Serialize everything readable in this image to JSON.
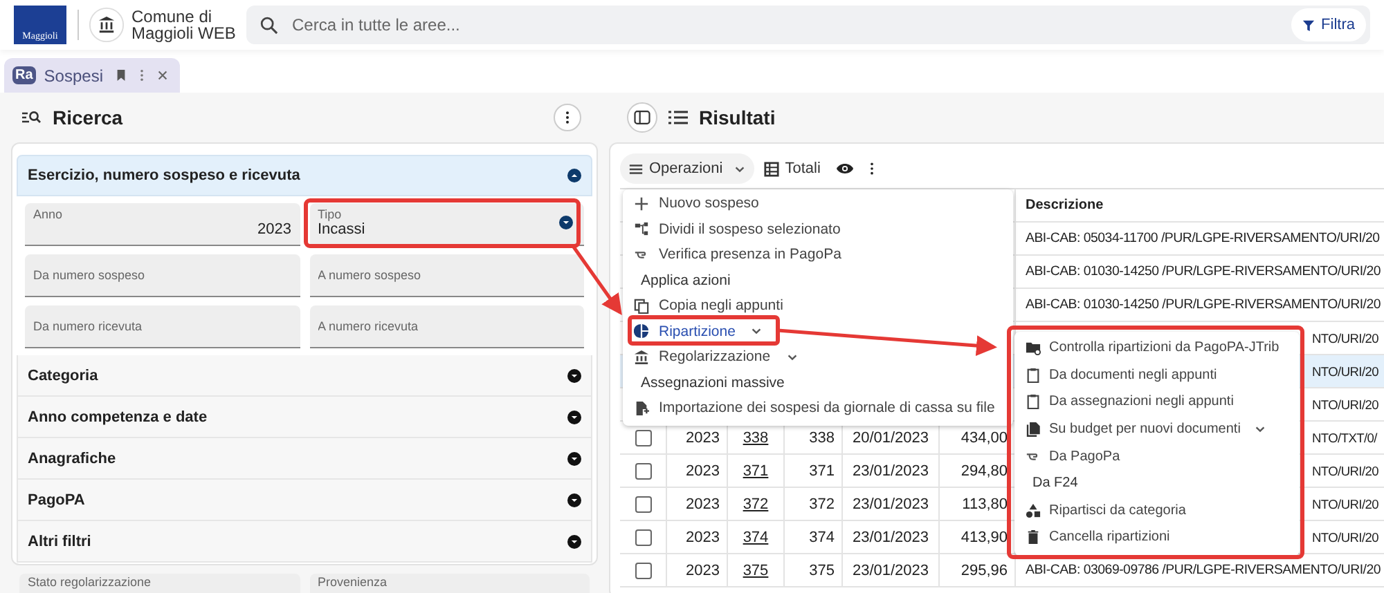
{
  "header": {
    "logo_text": "Maggioli",
    "app_title": "Comune di Maggioli WEB",
    "search": {
      "placeholder": "Cerca in tutte le aree..."
    },
    "filter_button": "Filtra"
  },
  "tabs": [
    {
      "icon_text": "Ra",
      "label": "Sospesi",
      "selected": true
    }
  ],
  "search_panel": {
    "title": "Ricerca",
    "sections": [
      {
        "title": "Esercizio, numero sospeso e ricevuta",
        "expanded": true,
        "fields": [
          {
            "kind": "value",
            "label": "Anno",
            "value": "2023"
          },
          {
            "kind": "select",
            "label": "Tipo",
            "value": "Incassi"
          },
          {
            "kind": "empty",
            "placeholder": "Da numero sospeso"
          },
          {
            "kind": "empty",
            "placeholder": "A numero sospeso"
          },
          {
            "kind": "empty",
            "placeholder": "Da numero ricevuta"
          },
          {
            "kind": "empty",
            "placeholder": "A numero ricevuta"
          }
        ]
      },
      {
        "title": "Categoria",
        "expanded": false
      },
      {
        "title": "Anno competenza e date",
        "expanded": false
      },
      {
        "title": "Anagrafiche",
        "expanded": false
      },
      {
        "title": "PagoPA",
        "expanded": false
      },
      {
        "title": "Altri filtri",
        "expanded": false
      }
    ],
    "extra_fields": [
      {
        "label": "Stato regolarizzazione"
      },
      {
        "label": "Provenienza"
      }
    ]
  },
  "results": {
    "title": "Risultati",
    "toolbar": {
      "operations": "Operazioni",
      "totals": "Totali"
    },
    "table": {
      "columns": [
        "Descrizione"
      ],
      "rows": [
        {
          "kind": "description_only",
          "selected": false,
          "description": "ABI-CAB: 05034-11700 /PUR/LGPE-RIVERSAMENTO/URI/20"
        },
        {
          "kind": "description_only",
          "selected": false,
          "description": "ABI-CAB: 01030-14250 /PUR/LGPE-RIVERSAMENTO/URI/20"
        },
        {
          "kind": "description_only",
          "selected": false,
          "description": "ABI-CAB: 01030-14250 /PUR/LGPE-RIVERSAMENTO/URI/20"
        },
        {
          "kind": "tail_only",
          "selected": false,
          "description": "NTO/URI/20"
        },
        {
          "kind": "tail_only",
          "selected": true,
          "description": "NTO/URI/20"
        },
        {
          "kind": "tail_only",
          "selected": false,
          "description": "NTO/URI/20"
        },
        {
          "kind": "full",
          "selected": false,
          "checked": false,
          "year": "2023",
          "number": "338",
          "receipt": "338",
          "date": "20/01/2023",
          "amount": "434,00",
          "description": "NTO/TXT/0/",
          "description_covered": true
        },
        {
          "kind": "full",
          "selected": false,
          "checked": false,
          "year": "2023",
          "number": "371",
          "receipt": "371",
          "date": "23/01/2023",
          "amount": "294,80",
          "description": "NTO/URI/20",
          "description_covered": true
        },
        {
          "kind": "full",
          "selected": false,
          "checked": false,
          "year": "2023",
          "number": "372",
          "receipt": "372",
          "date": "23/01/2023",
          "amount": "113,80",
          "description": "NTO/URI/20",
          "description_covered": true
        },
        {
          "kind": "full",
          "selected": false,
          "checked": false,
          "year": "2023",
          "number": "374",
          "receipt": "374",
          "date": "23/01/2023",
          "amount": "413,90",
          "description": "NTO/URI/20",
          "description_covered": true
        },
        {
          "kind": "full",
          "selected": false,
          "checked": false,
          "year": "2023",
          "number": "375",
          "receipt": "375",
          "date": "23/01/2023",
          "amount": "295,96",
          "description": "ABI-CAB: 03069-09786 /PUR/LGPE-RIVERSAMENTO/URI/20",
          "description_covered": false
        }
      ]
    },
    "operations_menu": [
      {
        "kind": "action",
        "label": "Nuovo sospeso",
        "selected": false,
        "has_submenu": false
      },
      {
        "kind": "action",
        "label": "Dividi il sospeso selezionato",
        "selected": false,
        "has_submenu": false
      },
      {
        "kind": "action",
        "label": "Verifica presenza in PagoPa",
        "selected": false,
        "has_submenu": false
      },
      {
        "kind": "heading",
        "label": "Applica azioni",
        "selected": false,
        "has_submenu": false
      },
      {
        "kind": "action",
        "label": "Copia negli appunti",
        "selected": false,
        "has_submenu": false
      },
      {
        "kind": "action",
        "label": "Ripartizione",
        "selected": true,
        "has_submenu": true
      },
      {
        "kind": "action",
        "label": "Regolarizzazione",
        "selected": false,
        "has_submenu": true
      },
      {
        "kind": "heading",
        "label": "Assegnazioni massive",
        "selected": false,
        "has_submenu": false
      },
      {
        "kind": "action",
        "label": "Importazione dei sospesi da giornale di cassa su file",
        "selected": false,
        "has_submenu": false
      }
    ],
    "submenu": [
      {
        "kind": "action",
        "label": "Controlla ripartizioni da PagoPA-JTrib",
        "has_submenu": false
      },
      {
        "kind": "action",
        "label": "Da documenti negli appunti",
        "has_submenu": false
      },
      {
        "kind": "action",
        "label": "Da assegnazioni negli appunti",
        "has_submenu": false
      },
      {
        "kind": "action",
        "label": "Su budget per nuovi documenti",
        "has_submenu": true
      },
      {
        "kind": "action",
        "label": "Da PagoPa",
        "has_submenu": false
      },
      {
        "kind": "heading",
        "label": "Da F24",
        "has_submenu": false
      },
      {
        "kind": "action",
        "label": "Ripartisci da categoria",
        "has_submenu": false
      },
      {
        "kind": "action",
        "label": "Cancella ripartizioni",
        "has_submenu": false
      }
    ]
  }
}
